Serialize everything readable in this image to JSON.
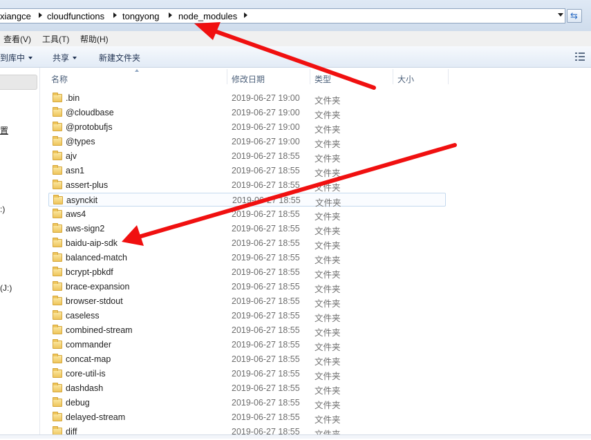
{
  "address": {
    "crumbs": [
      "xiangce",
      "cloudfunctions",
      "tongyong",
      "node_modules"
    ]
  },
  "menu": [
    "查看(V)",
    "工具(T)",
    "帮助(H)"
  ],
  "toolbar": {
    "include_library": "到库中",
    "share": "共享",
    "new_folder": "新建文件夹"
  },
  "nav": {
    "items": [
      "置",
      ":)",
      "(J:)"
    ]
  },
  "columns": {
    "name": "名称",
    "date": "修改日期",
    "type": "类型",
    "size": "大小"
  },
  "files": [
    {
      "name": ".bin",
      "date": "2019-06-27 19:00",
      "type": "文件夹"
    },
    {
      "name": "@cloudbase",
      "date": "2019-06-27 19:00",
      "type": "文件夹"
    },
    {
      "name": "@protobufjs",
      "date": "2019-06-27 19:00",
      "type": "文件夹"
    },
    {
      "name": "@types",
      "date": "2019-06-27 19:00",
      "type": "文件夹"
    },
    {
      "name": "ajv",
      "date": "2019-06-27 18:55",
      "type": "文件夹"
    },
    {
      "name": "asn1",
      "date": "2019-06-27 18:55",
      "type": "文件夹"
    },
    {
      "name": "assert-plus",
      "date": "2019-06-27 18:55",
      "type": "文件夹"
    },
    {
      "name": "asynckit",
      "date": "2019-06-27 18:55",
      "type": "文件夹"
    },
    {
      "name": "aws4",
      "date": "2019-06-27 18:55",
      "type": "文件夹"
    },
    {
      "name": "aws-sign2",
      "date": "2019-06-27 18:55",
      "type": "文件夹"
    },
    {
      "name": "baidu-aip-sdk",
      "date": "2019-06-27 18:55",
      "type": "文件夹"
    },
    {
      "name": "balanced-match",
      "date": "2019-06-27 18:55",
      "type": "文件夹"
    },
    {
      "name": "bcrypt-pbkdf",
      "date": "2019-06-27 18:55",
      "type": "文件夹"
    },
    {
      "name": "brace-expansion",
      "date": "2019-06-27 18:55",
      "type": "文件夹"
    },
    {
      "name": "browser-stdout",
      "date": "2019-06-27 18:55",
      "type": "文件夹"
    },
    {
      "name": "caseless",
      "date": "2019-06-27 18:55",
      "type": "文件夹"
    },
    {
      "name": "combined-stream",
      "date": "2019-06-27 18:55",
      "type": "文件夹"
    },
    {
      "name": "commander",
      "date": "2019-06-27 18:55",
      "type": "文件夹"
    },
    {
      "name": "concat-map",
      "date": "2019-06-27 18:55",
      "type": "文件夹"
    },
    {
      "name": "core-util-is",
      "date": "2019-06-27 18:55",
      "type": "文件夹"
    },
    {
      "name": "dashdash",
      "date": "2019-06-27 18:55",
      "type": "文件夹"
    },
    {
      "name": "debug",
      "date": "2019-06-27 18:55",
      "type": "文件夹"
    },
    {
      "name": "delayed-stream",
      "date": "2019-06-27 18:55",
      "type": "文件夹"
    },
    {
      "name": "diff",
      "date": "2019-06-27 18:55",
      "type": "文件夹"
    }
  ],
  "highlighted_item": "asynckit",
  "colors": {
    "annotation_arrow": "#f01010",
    "folder": "#eec55b",
    "selection_border": "#c4d9ee"
  }
}
